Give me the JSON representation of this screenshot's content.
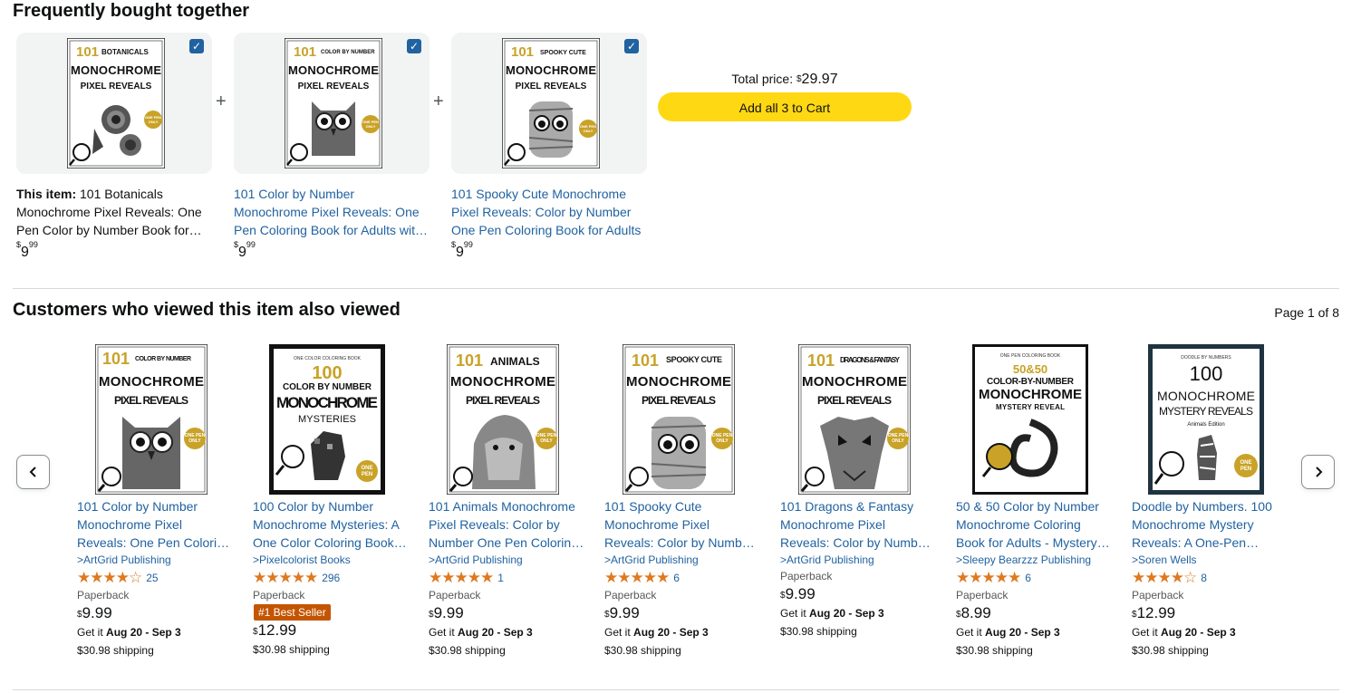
{
  "fbt": {
    "title": "Frequently bought together",
    "items": [
      {
        "prefix": "This item:",
        "title": "101 Botanicals Monochrome Pixel Reveals: One Pen Color by Number Book for Adults",
        "price_symbol": "$",
        "price_whole": "9",
        "price_fraction": "99",
        "cover_top": "101",
        "cover_sub": "BOTANICALS",
        "cover_main": "MONOCHROME",
        "cover_sub2": "PIXEL REVEALS",
        "cover_badge": "ONE PEN ONLY",
        "checked": true
      },
      {
        "prefix": "",
        "title": "101 Color by Number Monochrome Pixel Reveals: One Pen Coloring Book for Adults with Owls",
        "price_symbol": "$",
        "price_whole": "9",
        "price_fraction": "99",
        "cover_top": "101",
        "cover_sub": "COLOR BY NUMBER",
        "cover_main": "MONOCHROME",
        "cover_sub2": "PIXEL REVEALS",
        "cover_badge": "ONE PEN ONLY",
        "checked": true
      },
      {
        "prefix": "",
        "title": "101 Spooky Cute Monochrome Pixel Reveals: Color by Number One Pen Coloring Book for Adults",
        "price_symbol": "$",
        "price_whole": "9",
        "price_fraction": "99",
        "cover_top": "101",
        "cover_sub": "SPOOKY CUTE",
        "cover_main": "MONOCHROME",
        "cover_sub2": "PIXEL REVEALS",
        "cover_badge": "ONE PEN ONLY",
        "checked": true
      }
    ],
    "plus": "+",
    "total_label": "Total price:",
    "total_symbol": "$",
    "total_value": "29.97",
    "add_button": "Add all 3 to Cart"
  },
  "also_viewed": {
    "title": "Customers who viewed this item also viewed",
    "page_indicator": "Page 1 of 8",
    "prev_icon": "chevron-left-icon",
    "next_icon": "chevron-right-icon",
    "items": [
      {
        "title": "101 Color by Number Monochrome Pixel Reveals: One Pen Coloring Book for Adults",
        "author": "ArtGrid Publishing",
        "rating": 4.0,
        "stars": "★★★★☆",
        "review_count": "25",
        "format": "Paperback",
        "badge": "",
        "price_symbol": "$",
        "price": "9.99",
        "delivery_prefix": "Get it",
        "delivery_dates": "Aug 20 - Sep 3",
        "shipping": "$30.98 shipping",
        "cover_top": "101",
        "cover_sub": "COLOR BY NUMBER",
        "cover_main": "MONOCHROME",
        "cover_sub2": "PIXEL REVEALS",
        "cover_badge": "ONE PEN ONLY"
      },
      {
        "title": "100 Color by Number Monochrome Mysteries: A One Color Coloring Book for Adults",
        "author": "Pixelcolorist Books",
        "rating": 5.0,
        "stars": "★★★★★",
        "review_count": "296",
        "format": "Paperback",
        "badge": "#1 Best Seller",
        "price_symbol": "$",
        "price": "12.99",
        "delivery_prefix": "Get it",
        "delivery_dates": "Aug 20 - Sep 3",
        "shipping": "$30.98 shipping",
        "cover_top": "ONE COLOR COLORING BOOK",
        "cover_sub": "100",
        "cover_main": "COLOR BY NUMBER",
        "cover_sub2": "MONOCHROME",
        "cover_sub3": "MYSTERIES",
        "cover_badge": "ONE PEN ONLY"
      },
      {
        "title": "101 Animals Monochrome Pixel Reveals: Color by Number One Pen Coloring Book",
        "author": "ArtGrid Publishing",
        "rating": 5.0,
        "stars": "★★★★★",
        "review_count": "1",
        "format": "Paperback",
        "badge": "",
        "price_symbol": "$",
        "price": "9.99",
        "delivery_prefix": "Get it",
        "delivery_dates": "Aug 20 - Sep 3",
        "shipping": "$30.98 shipping",
        "cover_top": "101",
        "cover_sub": "ANIMALS",
        "cover_main": "MONOCHROME",
        "cover_sub2": "PIXEL REVEALS",
        "cover_badge": "ONE PEN ONLY"
      },
      {
        "title": "101 Spooky Cute Monochrome Pixel Reveals: Color by Number One Pen Coloring Book",
        "author": "ArtGrid Publishing",
        "rating": 5.0,
        "stars": "★★★★★",
        "review_count": "6",
        "format": "Paperback",
        "badge": "",
        "price_symbol": "$",
        "price": "9.99",
        "delivery_prefix": "Get it",
        "delivery_dates": "Aug 20 - Sep 3",
        "shipping": "$30.98 shipping",
        "cover_top": "101",
        "cover_sub": "SPOOKY CUTE",
        "cover_main": "MONOCHROME",
        "cover_sub2": "PIXEL REVEALS",
        "cover_badge": "ONE PEN ONLY"
      },
      {
        "title": "101 Dragons & Fantasy Monochrome Pixel Reveals: Color by Number Coloring Book for Adults",
        "author": "ArtGrid Publishing",
        "rating": 0,
        "stars": "",
        "review_count": "",
        "format": "Paperback",
        "badge": "",
        "price_symbol": "$",
        "price": "9.99",
        "delivery_prefix": "Get it",
        "delivery_dates": "Aug 20 - Sep 3",
        "shipping": "$30.98 shipping",
        "cover_top": "101",
        "cover_sub": "DRAGONS & FANTASY",
        "cover_main": "MONOCHROME",
        "cover_sub2": "PIXEL REVEALS",
        "cover_badge": "ONE PEN ONLY"
      },
      {
        "title": "50 & 50 Color by Number Monochrome Coloring Book for Adults - Mystery Reveal",
        "author": "Sleepy Bearzzz Publishing",
        "rating": 5.0,
        "stars": "★★★★★",
        "review_count": "6",
        "format": "Paperback",
        "badge": "",
        "price_symbol": "$",
        "price": "8.99",
        "delivery_prefix": "Get it",
        "delivery_dates": "Aug 20 - Sep 3",
        "shipping": "$30.98 shipping",
        "cover_top": "ONE PEN COLORING BOOK",
        "cover_sub": "50&50",
        "cover_main": "COLOR-BY-NUMBER",
        "cover_sub2": "MONOCHROME",
        "cover_sub3": "MYSTERY REVEAL",
        "cover_badge": ""
      },
      {
        "title": "Doodle by Numbers. 100 Monochrome Mystery Reveals: A One-Pen Coloring Book",
        "author": "Soren Wells",
        "rating": 4.0,
        "stars": "★★★★☆",
        "review_count": "8",
        "format": "Paperback",
        "badge": "",
        "price_symbol": "$",
        "price": "12.99",
        "delivery_prefix": "Get it",
        "delivery_dates": "Aug 20 - Sep 3",
        "shipping": "$30.98 shipping",
        "cover_top": "DOODLE BY NUMBERS",
        "cover_sub": "100",
        "cover_main": "MONOCHROME",
        "cover_sub2": "MYSTERY REVEALS",
        "cover_sub3": "Animals Edition",
        "cover_badge": "ONE PEN ONLY"
      }
    ]
  },
  "colors": {
    "link": "#2162a1",
    "star": "#de7921",
    "button_yellow": "#ffd814",
    "badge_orange": "#c45500",
    "checkbox_blue": "#2162a1",
    "card_bg": "#f2f3f3",
    "gold": "#c9a227"
  }
}
